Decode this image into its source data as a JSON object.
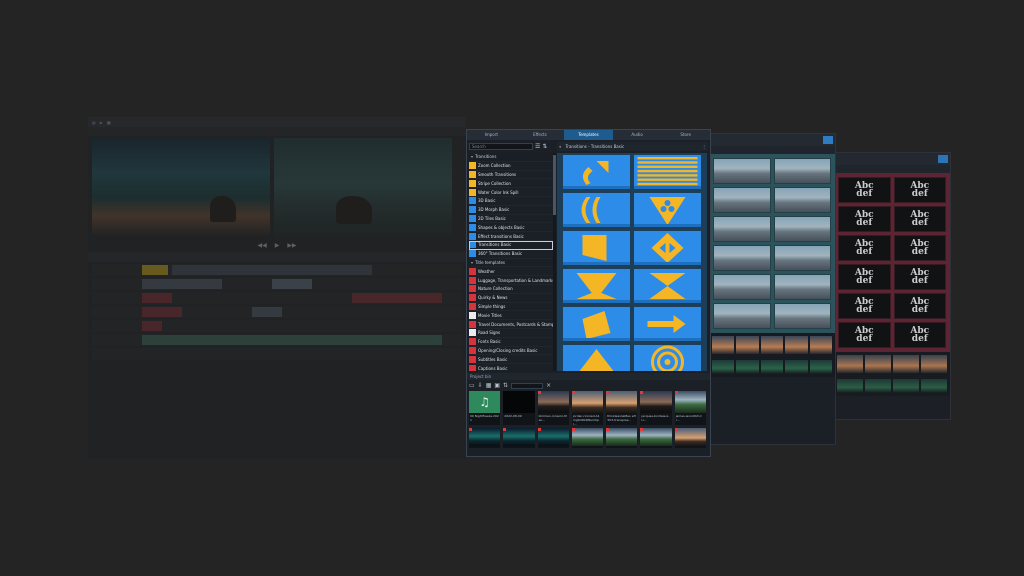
{
  "main": {
    "tabs": [
      {
        "label": "Import",
        "active": false
      },
      {
        "label": "Effects",
        "active": false
      },
      {
        "label": "Templates",
        "active": true
      },
      {
        "label": "Audio",
        "active": false
      },
      {
        "label": "Store",
        "active": false
      }
    ],
    "search_placeholder": "Search",
    "breadcrumb": "Transitions - Transitions Basic",
    "categories": [
      {
        "label": "Transitions",
        "group": true,
        "swatch": ""
      },
      {
        "label": "Zoom Collection",
        "swatch": "yel"
      },
      {
        "label": "Smooth Transitions",
        "swatch": "yel"
      },
      {
        "label": "Stripe Collection",
        "swatch": "yel"
      },
      {
        "label": "Water Color Ink Spill",
        "swatch": "yel"
      },
      {
        "label": "3D Basic",
        "swatch": "blu"
      },
      {
        "label": "3D Morph Basic",
        "swatch": "blu"
      },
      {
        "label": "2D Tiles Basic",
        "swatch": "blu"
      },
      {
        "label": "Shapes & objects Basic",
        "swatch": "blu"
      },
      {
        "label": "Effect transitions Basic",
        "swatch": "blu"
      },
      {
        "label": "Transitions Basic",
        "swatch": "blu",
        "selected": true
      },
      {
        "label": "360° Transitions Basic",
        "swatch": "blu"
      },
      {
        "label": "Title templates",
        "group": true,
        "swatch": ""
      },
      {
        "label": "Weather",
        "swatch": "red"
      },
      {
        "label": "Luggage, Transportation & Landmarks",
        "swatch": "red"
      },
      {
        "label": "Nature Collection",
        "swatch": "red"
      },
      {
        "label": "Quirky & News",
        "swatch": "red"
      },
      {
        "label": "Simple things",
        "swatch": "red"
      },
      {
        "label": "Movie Titles",
        "swatch": "wht"
      },
      {
        "label": "Travel Documents, Postcards & Stamps",
        "swatch": "red"
      },
      {
        "label": "Road Signs",
        "swatch": "wht"
      },
      {
        "label": "Fonts Basic",
        "swatch": "red"
      },
      {
        "label": "Opening/Closing credits Basic",
        "swatch": "red"
      },
      {
        "label": "Subtitles Basic",
        "swatch": "red"
      },
      {
        "label": "Captions Basic",
        "swatch": "red"
      },
      {
        "label": "Movement Basic",
        "swatch": "red"
      }
    ],
    "tile_icons": [
      "curved-arrow-icon",
      "horizontal-stripes-icon",
      "arc-shapes-icon",
      "triangle-dots-icon",
      "page-fold-icon",
      "diamond-arrows-icon",
      "wedge-icon",
      "hourglass-icon",
      "tilted-square-icon",
      "arrow-right-icon",
      "triangle-icon",
      "concentric-circles-icon"
    ],
    "colors": {
      "tile_bg": "#2d8ce8",
      "tile_shape": "#f5b626",
      "tab_active": "#1e5b8e",
      "tile_area": "#1c3e58"
    }
  },
  "project_bin": {
    "title": "Project bin",
    "items": [
      {
        "type": "music",
        "caption": "00 Nightfreeze.2021"
      },
      {
        "type": "black",
        "caption": "2022-08-09"
      },
      {
        "type": "rocks",
        "caption": "kimmen-ronsom-Meo..."
      },
      {
        "type": "sunset",
        "caption": "jordan-rinnzed-A1 mg9UDkDNumbpl..."
      },
      {
        "type": "sunset",
        "caption": "thinkleavlieMeo eH3U3-transpres..."
      },
      {
        "type": "rocks",
        "caption": "jacques-bordeaux-U..."
      },
      {
        "type": "field",
        "caption": "james-wooditch-tr..."
      },
      {
        "type": "aurora",
        "caption": ""
      },
      {
        "type": "aurora",
        "caption": ""
      },
      {
        "type": "aurora",
        "caption": ""
      },
      {
        "type": "field",
        "caption": ""
      },
      {
        "type": "field",
        "caption": ""
      },
      {
        "type": "field",
        "caption": ""
      },
      {
        "type": "sunset",
        "caption": ""
      }
    ]
  },
  "font_panel": {
    "tile_text": "Abc\ndef",
    "tile_color": "#6a2437"
  },
  "city_panel": {
    "tile_color": "#2b5963"
  }
}
